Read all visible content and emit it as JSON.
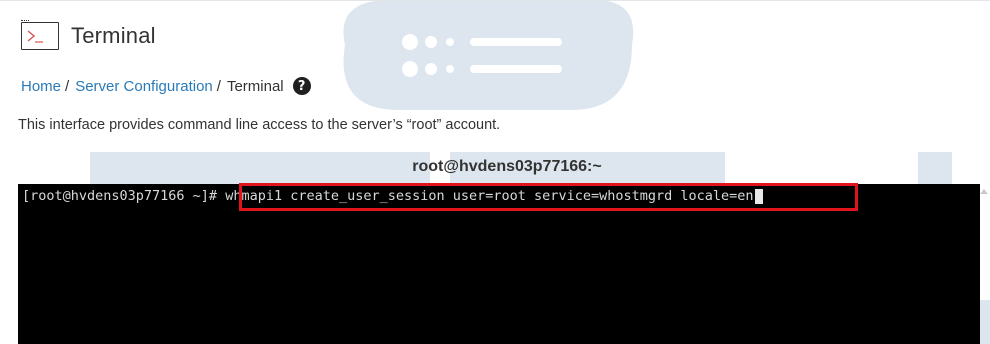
{
  "header": {
    "title": "Terminal",
    "icon": "terminal-icon"
  },
  "breadcrumb": {
    "items": [
      {
        "label": "Home"
      },
      {
        "label": "Server Configuration"
      }
    ],
    "separator": "/",
    "current": "Terminal",
    "help_icon": "?"
  },
  "description": "This interface provides command line access to the server’s “root” account.",
  "terminal": {
    "host": "root@hvdens03p77166:~",
    "prompt": "[root@hvdens03p77166 ~]# ",
    "command": "whmapi1 create_user_session user=root service=whostmgrd locale=en"
  },
  "colors": {
    "link": "#2a7ab8",
    "highlight_border": "#e0141a",
    "terminal_bg": "#000000",
    "watermark": "#dfe7ee"
  }
}
